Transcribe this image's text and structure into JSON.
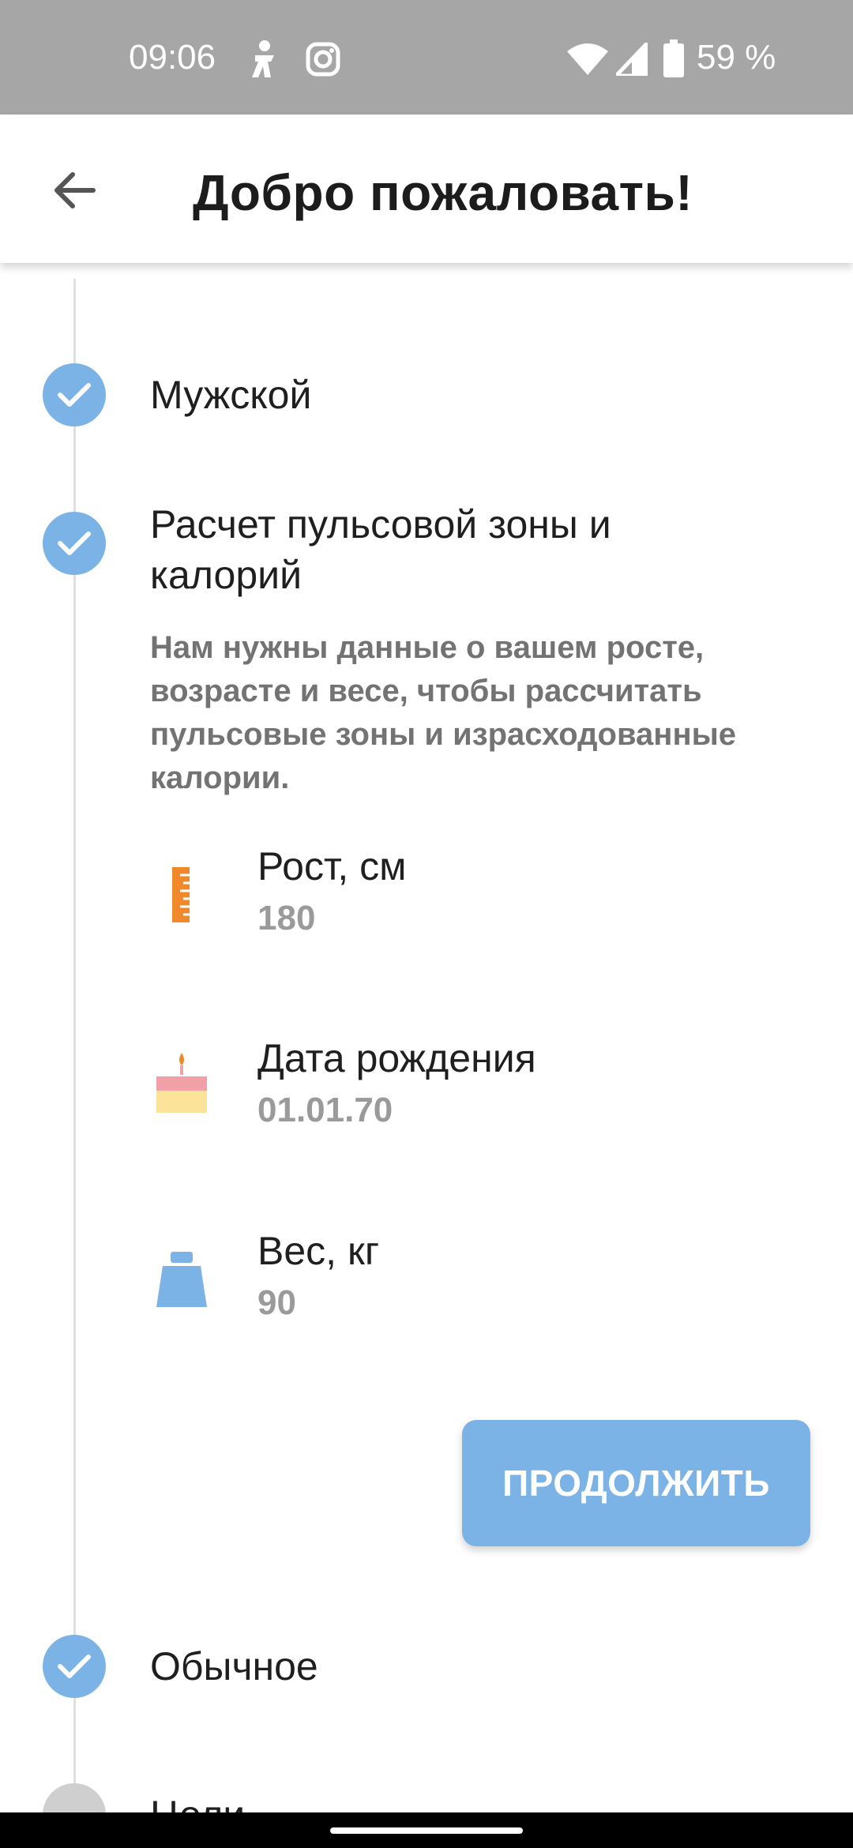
{
  "status_bar": {
    "time": "09:06",
    "battery_percent": "59 %",
    "icons": [
      "accessibility-icon",
      "instagram-icon",
      "wifi-icon",
      "signal-icon",
      "battery-icon"
    ]
  },
  "app_bar": {
    "title": "Добро пожаловать!",
    "back_icon": "arrow-back-icon"
  },
  "steps": {
    "gender": {
      "title": "Мужской",
      "state": "done"
    },
    "calc": {
      "title": "Расчет пульсовой зоны и калорий",
      "description": "Нам нужны данные о вашем росте, возрасте и весе, чтобы рассчитать пульсовые зоны и израсходованные калории.",
      "state": "done"
    },
    "activity": {
      "title": "Обычное",
      "state": "done"
    },
    "goals": {
      "title": "Цели",
      "state": "pending"
    }
  },
  "fields": {
    "height": {
      "label": "Рост, см",
      "value": "180",
      "icon": "ruler-icon"
    },
    "birthdate": {
      "label": "Дата рождения",
      "value": "01.01.70",
      "icon": "cake-icon"
    },
    "weight": {
      "label": "Вес, кг",
      "value": "90",
      "icon": "weight-icon"
    }
  },
  "buttons": {
    "continue_label": "ПРОДОЛЖИТЬ"
  },
  "colors": {
    "accent": "#7cb3e6",
    "status_bar": "#a6a6a6",
    "ruler": "#f0892a",
    "cake": "#f2a0a8",
    "weight": "#7cb3e6"
  }
}
